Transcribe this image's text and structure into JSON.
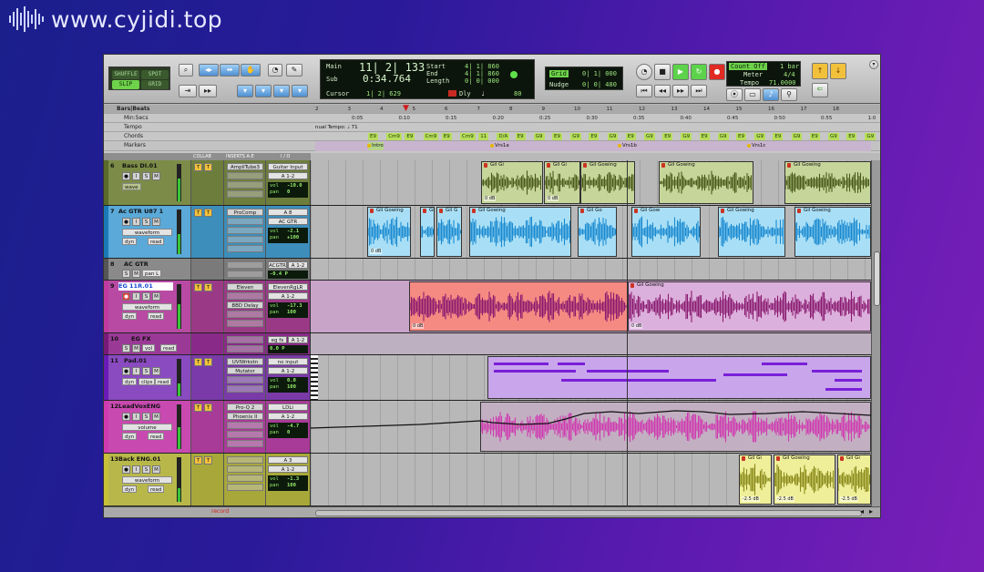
{
  "watermark": {
    "text": "www.cyjidi.top"
  },
  "toolbar": {
    "modes": {
      "shuffle": "SHUFFLE",
      "spot": "SPOT",
      "slip": "SLIP",
      "grid": "GRID"
    },
    "counter": {
      "main_label": "Main",
      "main_value": "11| 2| 133",
      "sub_label": "Sub",
      "sub_value": "0:34.764",
      "cursor_label": "Cursor",
      "cursor_value": "1| 2| 629",
      "start_label": "Start",
      "start_value": "4| 1| 860",
      "end_label": "End",
      "end_value": "4| 1| 860",
      "length_label": "Length",
      "length_value": "0| 0| 000",
      "dly_label": "Dly",
      "dly_value": "80",
      "grid_label": "Grid",
      "grid_value": "0| 1| 000",
      "nudge_label": "Nudge",
      "nudge_value": "0| 0| 480"
    },
    "transport_status": {
      "count_off": "Count Off",
      "meter_label": "Meter",
      "tempo_label": "Tempo",
      "bar_value": "1 bar",
      "meter_value": "4/4",
      "tempo_value": "71.0000"
    }
  },
  "rulers": {
    "bars_label": "Bars|Beats",
    "minsecs_label": "Min:Secs",
    "tempo_label": "Tempo",
    "chords_label": "Chords",
    "markers_label": "Markers",
    "manual_tempo": "nual Tempo: ♩ 71",
    "bars": [
      "2",
      "3",
      "4",
      "5",
      "6",
      "7",
      "8",
      "9",
      "10",
      "11",
      "12",
      "13",
      "14",
      "15",
      "16",
      "17",
      "18"
    ],
    "times": [
      "0:05",
      "0:10",
      "0:15",
      "0:20",
      "0:25",
      "0:30",
      "0:35",
      "0:40",
      "0:45",
      "0:50",
      "0:55",
      "1:0"
    ],
    "chords": [
      "E9",
      "Cm9",
      "E9",
      "Cm9",
      "E9",
      "Cm9",
      "11",
      "D/A",
      "E9",
      "G9",
      "E9",
      "G9",
      "E9",
      "G9",
      "E9",
      "G9",
      "E9",
      "G9",
      "E9",
      "G9",
      "E9",
      "G9",
      "E9",
      "G9",
      "E9",
      "G9",
      "E9",
      "G9",
      "E9"
    ],
    "markers": [
      "Intro",
      "Vrs1a",
      "Vrs1b",
      "Vrs1c"
    ]
  },
  "column_headers": {
    "collab": "COLLAB",
    "inserts": "INSERTS A-E",
    "io": "I / O"
  },
  "tracks": [
    {
      "num": "6",
      "name": "Bass DI.01",
      "view": "wave",
      "ins": [
        "AmpliTube3"
      ],
      "io_in": "Guitar Input",
      "io_out": "A 1-2",
      "vol": "-10.0",
      "pan": "0",
      "color": "#6a7a3a"
    },
    {
      "num": "7",
      "name": "Ac GTR U87 1",
      "view": "waveform",
      "ins": [
        "ProComp"
      ],
      "io_in": "A 8",
      "io_out": "AC GTR",
      "vol": "-2.1",
      "pan": "+100",
      "color": "#2a9ad6"
    },
    {
      "num": "8",
      "name": "AC GTR",
      "view": "pan L",
      "ins": [],
      "io_in": "ACGTR",
      "io_out": "A 1-2",
      "vol": "-0.4",
      "pan": "P",
      "color": "#555"
    },
    {
      "num": "9",
      "name": "EG 11R.01",
      "view": "waveform",
      "ins": [
        "Eleven",
        "BBD Delay"
      ],
      "io_in": "ElevenRgLR",
      "io_out": "A 1-2",
      "vol": "-17.3",
      "pan": "100",
      "color": "#c03aa0"
    },
    {
      "num": "10",
      "name": "EG FX",
      "view": "vol",
      "ins": [],
      "io_in": "eg fx",
      "io_out": "A 1-2",
      "vol": "0.0",
      "pan": "P",
      "color": "#8a2a88"
    },
    {
      "num": "11",
      "name": "Pad.01",
      "view": "clips",
      "ins": [
        "UVIWrkstn",
        "Mutator"
      ],
      "io_in": "no input",
      "io_out": "A 1-2",
      "vol": "0.0",
      "pan": "100",
      "color": "#7a2ac8"
    },
    {
      "num": "12",
      "name": "LeadVoxENG",
      "view": "volume",
      "ins": [
        "Pro-Q 2",
        "Phoenix II"
      ],
      "io_in": "LDLi",
      "io_out": "A 1-2",
      "vol": "-4.7",
      "pan": "0",
      "color": "#d03ab0"
    },
    {
      "num": "13",
      "name": "Back ENG.01",
      "view": "waveform",
      "ins": [],
      "io_in": "A 3",
      "io_out": "A 1-2",
      "vol": "-1.3",
      "pan": "100",
      "color": "#c9c03a"
    }
  ],
  "clips": {
    "gil": "Gil Gowing",
    "gil_short1": "Gil Gi",
    "gil_short2": "Gil Gi",
    "gil_short3": "Gil Gowi",
    "gil_short4": "Gil Gow",
    "gil_short5": "Gil G",
    "gil_short6": "Gil Go",
    "gil_short7": "Gil Gowin",
    "db0": "0 dB",
    "db_neg": "-2.5 dB"
  },
  "footer": {
    "label": "record"
  }
}
